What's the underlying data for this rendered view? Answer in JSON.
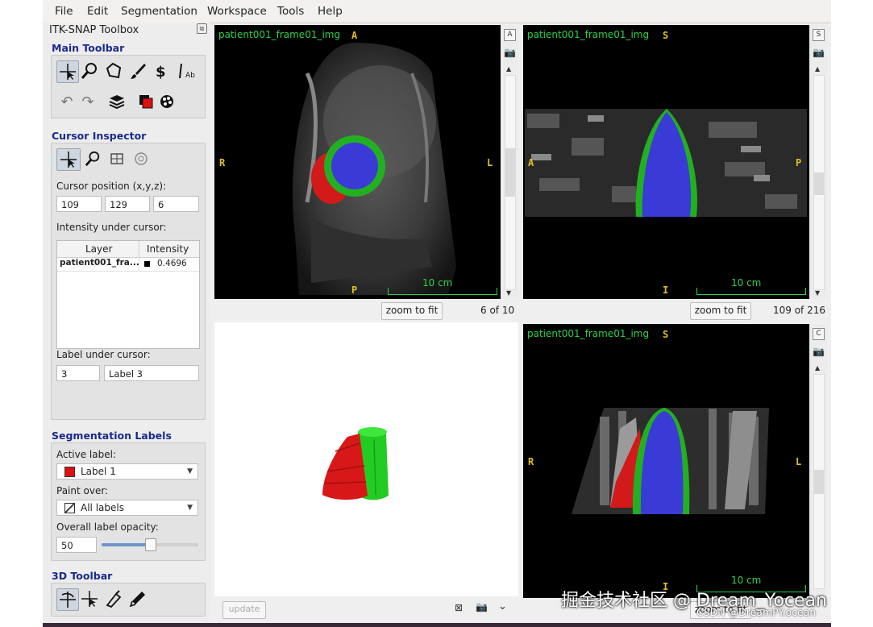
{
  "menu": [
    "File",
    "Edit",
    "Segmentation",
    "Workspace",
    "Tools",
    "Help"
  ],
  "toolbox": {
    "title": "ITK-SNAP Toolbox",
    "main_toolbar_label": "Main Toolbar",
    "cursor_inspector_label": "Cursor Inspector",
    "cursor_position_label": "Cursor position (x,y,z):",
    "cursor_x": "109",
    "cursor_y": "129",
    "cursor_z": "6",
    "intensity_label": "Intensity under cursor:",
    "table_headers": [
      "Layer",
      "Intensity"
    ],
    "table_rows": [
      {
        "layer": "patient001_fra...",
        "intensity": "0.4696"
      }
    ],
    "label_under_cursor_label": "Label under cursor:",
    "label_id": "3",
    "label_name": "Label 3",
    "seg_labels_label": "Segmentation Labels",
    "active_label_label": "Active label:",
    "active_label": "Label 1",
    "active_label_color": "#e01010",
    "paint_over_label": "Paint over:",
    "paint_over": "All labels",
    "opacity_label": "Overall label opacity:",
    "opacity_value": "50",
    "toolbar3d_label": "3D Toolbar"
  },
  "views": {
    "top_left": {
      "name": "patient001_frame01_img",
      "top": "A",
      "bottom": "P",
      "left": "R",
      "right": "L",
      "scale": "10 cm",
      "zoom": "zoom to fit",
      "slice": "6 of 10",
      "tag": "A"
    },
    "top_right": {
      "name": "patient001_frame01_img",
      "top": "S",
      "bottom": "I",
      "left": "A",
      "right": "P",
      "scale": "10 cm",
      "zoom": "zoom to fit",
      "slice": "109 of 216",
      "tag": "S"
    },
    "bottom_right": {
      "name": "patient001_frame01_img",
      "top": "S",
      "bottom": "I",
      "left": "R",
      "right": "L",
      "scale": "10 cm",
      "zoom": "zoom to fit",
      "tag": "C"
    },
    "bottom_left": {
      "update": "update"
    }
  },
  "colors": {
    "lv_blood": "#3a3ad6",
    "myocardium": "#22b022",
    "rv": "#d21a1a",
    "overlay_text": "#2bd14a",
    "orient_text": "#e0c020"
  },
  "watermark": "掘金技术社区 @ Dream_Yocean",
  "watermark_sub": "CSDN @DreamPY.ocean"
}
